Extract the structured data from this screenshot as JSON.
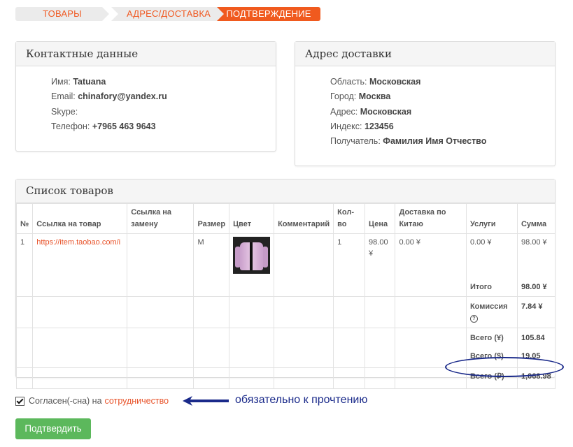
{
  "steps": [
    {
      "label": "ТОВАРЫ"
    },
    {
      "label": "АДРЕС/ДОСТАВКА"
    },
    {
      "label": "ПОДТВЕРЖДЕНИЕ"
    }
  ],
  "contacts": {
    "title": "Контактные данные",
    "name_label": "Имя:",
    "name_value": "Tatuana",
    "email_label": "Email:",
    "email_value": "chinafory@yandex.ru",
    "skype_label": "Skype:",
    "skype_value": "",
    "phone_label": "Телефон:",
    "phone_value": "+7965 463 9643"
  },
  "delivery": {
    "title": "Адрес доставки",
    "region_label": "Область:",
    "region_value": "Московская",
    "city_label": "Город:",
    "city_value": "Москва",
    "address_label": "Адрес:",
    "address_value": "Московская",
    "zip_label": "Индекс:",
    "zip_value": "123456",
    "recipient_label": "Получатель:",
    "recipient_value": "Фамилия Имя Отчество"
  },
  "items": {
    "title": "Список товаров",
    "columns": {
      "num": "№",
      "link": "Ссылка на товар",
      "replace": "Ссылка на замену",
      "size": "Размер",
      "color": "Цвет",
      "comment": "Комментарий",
      "qty": "Кол-во",
      "price": "Цена",
      "china_delivery": "Доставка по Китаю",
      "services": "Услуги",
      "sum": "Сумма"
    },
    "rows": [
      {
        "num": "1",
        "link": "https://item.taobao.com/i",
        "replace": "",
        "size": "M",
        "comment": "",
        "qty": "1",
        "price": "98.00 ¥",
        "china_delivery": "0.00 ¥",
        "services": "0.00 ¥",
        "sum": "98.00 ¥"
      }
    ],
    "totals": {
      "itogo_label": "Итого",
      "itogo_value": "98.00 ¥",
      "commission_label": "Комиссия",
      "commission_value": "7.84 ¥",
      "total_yuan_label": "Всего (¥)",
      "total_yuan_value": "105.84",
      "total_usd_label": "Всего ($)",
      "total_usd_value": "19.05",
      "total_rub_label": "Всего (₽)",
      "total_rub_value": "1,068.98"
    }
  },
  "agree": {
    "text": "Согласен(-сна) на",
    "link": "сотрудничество",
    "checked": true
  },
  "note": "обязательно к прочтению",
  "confirm_button": "Подтвердить",
  "colors": {
    "accent": "#f05a1e",
    "link": "#e8532a",
    "button": "#5cb85c",
    "annotation": "#1a2a8a"
  }
}
